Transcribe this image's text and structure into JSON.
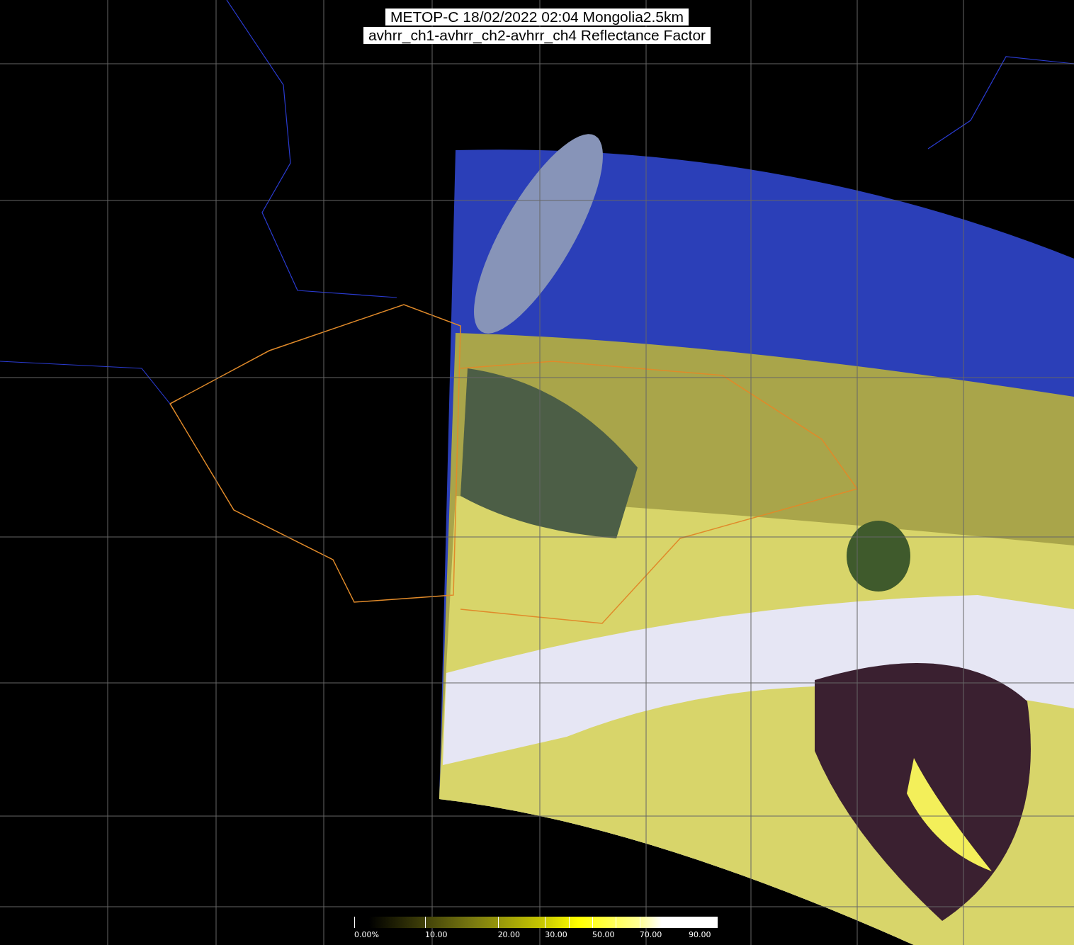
{
  "title": {
    "lines": [
      "METOP-C 18/02/2022 02:04 Mongolia2.5km",
      "avhrr_ch1-avhrr_ch2-avhrr_ch4 Reflectance Factor"
    ]
  },
  "colorbar": {
    "labels": [
      "0.00%",
      "10.00",
      "20.00",
      "30.00",
      "50.00",
      "70.00",
      "90.00"
    ]
  }
}
